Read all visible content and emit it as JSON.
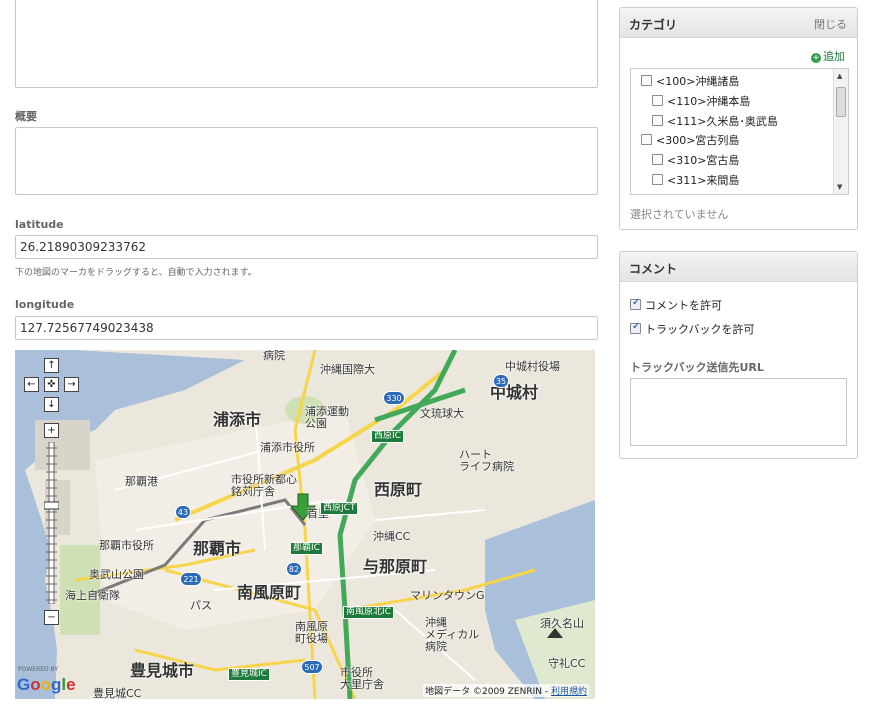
{
  "form": {
    "excerpt_label": "概要",
    "latitude_label": "latitude",
    "latitude_value": "26.21890309233762",
    "hint": "下の地図のマーカをドラッグすると、自動で入力されます。",
    "longitude_label": "longitude",
    "longitude_value": "127.72567749023438"
  },
  "map": {
    "labels": {
      "hospital_top": "病院",
      "okinawa_kokusai": "沖縄国際大",
      "nakagusuku_port": "中城村役場",
      "nakagusuku": "中城村",
      "urasoe": "浦添市",
      "urasoe_park": "浦添運動\n公園",
      "bunri": "文琉球大",
      "urasoe_cityhall": "浦添市役所",
      "heart": "ハート\nライフ病院",
      "naha_port": "那覇港",
      "shintoshin": "市役所新都心\n銘苅庁舎",
      "nishihara": "西原町",
      "shuri": "首里",
      "okinawa_cc": "沖縄CC",
      "naha_cityhall": "那覇市役所",
      "naha": "那覇市",
      "yonabaru": "与那原町",
      "onoyama": "奥武山公園",
      "jsdf": "海上自衛隊",
      "bypass": "パス",
      "haebaru": "南風原町",
      "marine": "マリンタウンG",
      "haebaru_office": "南風原\n町役場",
      "okinawa_medical": "沖縄\nメディカル\n病院",
      "sukuna": "須久名山",
      "moriya": "守礼CC",
      "tomigusuku": "豊見城市",
      "oosato": "市役所\n大里庁舎",
      "tomigusuku_cc": "豊見城CC"
    },
    "signs": {
      "nishihara_ic": "西原IC",
      "nishihara_jct": "西原JCT",
      "naha_ic": "那覇IC",
      "haebaru_kita": "南風原北IC",
      "tomigusuku_ic": "豊見城IC",
      "expressway": "沖縄自動車道"
    },
    "routes": {
      "r330": "330",
      "r35": "35",
      "r43": "43",
      "r221": "221",
      "r82": "82",
      "r507": "507"
    },
    "attribution": "地図データ ©2009 ZENRIN -",
    "terms": "利用規約",
    "powered": "POWERED BY",
    "google": "Google",
    "controls": {
      "up": "↑",
      "left": "←",
      "center": "✜",
      "right": "→",
      "down": "↓",
      "zoom_in": "+",
      "zoom_out": "−"
    }
  },
  "category_panel": {
    "title": "カテゴリ",
    "toggle": "閉じる",
    "add": "追加",
    "items": [
      {
        "label": "<100>沖縄諸島",
        "checked": false
      },
      {
        "label": "<110>沖縄本島",
        "checked": false
      },
      {
        "label": "<111>久米島･奥武島",
        "checked": false
      },
      {
        "label": "<300>宮古列島",
        "checked": false
      },
      {
        "label": "<310>宮古島",
        "checked": false
      },
      {
        "label": "<311>来間島",
        "checked": false
      }
    ],
    "none_selected": "選択されていません"
  },
  "comment_panel": {
    "title": "コメント",
    "allow_comments": "コメントを許可",
    "allow_trackbacks": "トラックバックを許可",
    "trackback_label": "トラックバック送信先URL",
    "trackback_value": ""
  }
}
